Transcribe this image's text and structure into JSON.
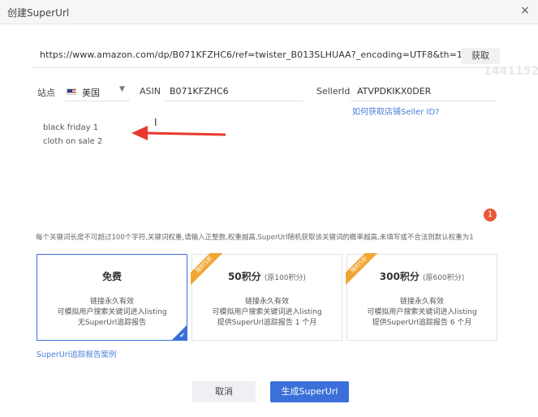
{
  "window": {
    "title": "创建SuperUrl",
    "close_icon": "×"
  },
  "url_input": {
    "value": "https://www.amazon.com/dp/B071KFZHC6/ref=twister_B013SLHUAA?_encoding=UTF8&th=1",
    "fetch_label": "获取"
  },
  "watermark": "1441152",
  "site": {
    "label": "站点",
    "value": "美国",
    "flag_icon": "us-flag-icon"
  },
  "asin": {
    "label": "ASIN",
    "value": "B071KFZHC6"
  },
  "seller": {
    "label": "SellerId",
    "value": "ATVPDKIKX0DER",
    "help_link": "如何获取店铺Seller ID?"
  },
  "keywords": {
    "lines": [
      "black friday 1",
      "cloth on sale 2"
    ]
  },
  "keyword_count_badge": "1",
  "hint": "每个关键词长度不可超过100个字符,关键词权重,请输入正整数,权重越高,SuperUrl随机获取该关键词的概率越高,未填写或不合法则默认权重为1",
  "plans": [
    {
      "name": "免费",
      "orig": "",
      "ribbon": "",
      "desc": [
        "链接永久有效",
        "可模拟用户搜索关键词进入listing",
        "无SuperUrl追踪报告"
      ],
      "selected": true
    },
    {
      "name": "50积分",
      "orig": "(原100积分)",
      "ribbon": "限时5折",
      "desc": [
        "链接永久有效",
        "可模拟用户搜索关键词进入listing",
        "提供SuperUrl追踪报告 1 个月"
      ],
      "selected": false
    },
    {
      "name": "300积分",
      "orig": "(原600积分)",
      "ribbon": "限时5折",
      "desc": [
        "链接永久有效",
        "可模拟用户搜索关键词进入listing",
        "提供SuperUrl追踪报告 6 个月"
      ],
      "selected": false
    }
  ],
  "case_link": "SuperUrl追踪报告案例",
  "buttons": {
    "cancel": "取消",
    "generate": "生成SuperUrl"
  },
  "colors": {
    "primary": "#3b6fd9",
    "badge": "#e8583c",
    "ribbon": "#f2a533",
    "arrow": "#e8392e"
  }
}
